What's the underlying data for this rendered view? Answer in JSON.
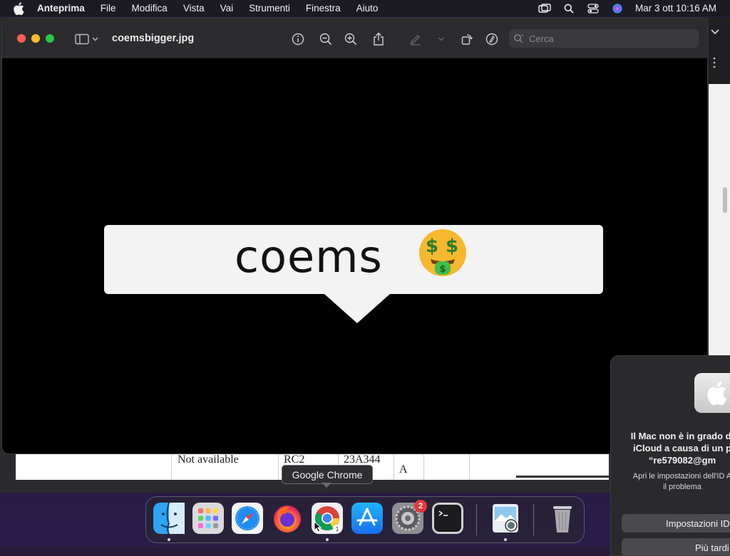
{
  "menubar": {
    "app_name": "Anteprima",
    "items": [
      "File",
      "Modifica",
      "Vista",
      "Vai",
      "Strumenti",
      "Finestra",
      "Aiuto"
    ],
    "status_icons": [
      "screen-mirroring-icon",
      "spotlight-search-icon",
      "control-center-icon",
      "siri-icon"
    ],
    "clock": "Mar 3 ott  10:16 AM"
  },
  "preview": {
    "title": "coemsbigger.jpg",
    "search_placeholder": "Cerca",
    "toolbar_icons": [
      "sidebar-toggle-icon",
      "info-icon",
      "zoom-out-icon",
      "zoom-in-icon",
      "share-icon",
      "markup-pen-icon",
      "rotate-icon",
      "annotate-icon"
    ],
    "image": {
      "bubble_text": "coems",
      "emoji": "money-mouth-face-emoji"
    }
  },
  "background_doc": {
    "cells": [
      "Not available",
      "RC2",
      "23A344",
      "A"
    ]
  },
  "tooltip": {
    "text": "Google Chrome"
  },
  "dock": {
    "items": [
      {
        "name": "Finder"
      },
      {
        "name": "Launchpad"
      },
      {
        "name": "Safari"
      },
      {
        "name": "Firefox"
      },
      {
        "name": "Google Chrome"
      },
      {
        "name": "App Store"
      },
      {
        "name": "Impostazioni di Sistema",
        "badge": "2"
      },
      {
        "name": "Terminale"
      },
      {
        "name": "Anteprima"
      },
      {
        "name": "Cestino"
      }
    ]
  },
  "notification": {
    "title_lines": [
      "Il Mac non è in grado di",
      "iCloud a causa di un p",
      "“re579082@gm"
    ],
    "body_lines": [
      "Apri le impostazioni dell'ID A",
      "il problema"
    ],
    "primary_button": "Impostazioni ID",
    "secondary_button": "Più tardi"
  },
  "colors": {
    "close": "#ff5f57",
    "minimize": "#febc2e",
    "maximize": "#28c840",
    "badge": "#e5383b"
  }
}
